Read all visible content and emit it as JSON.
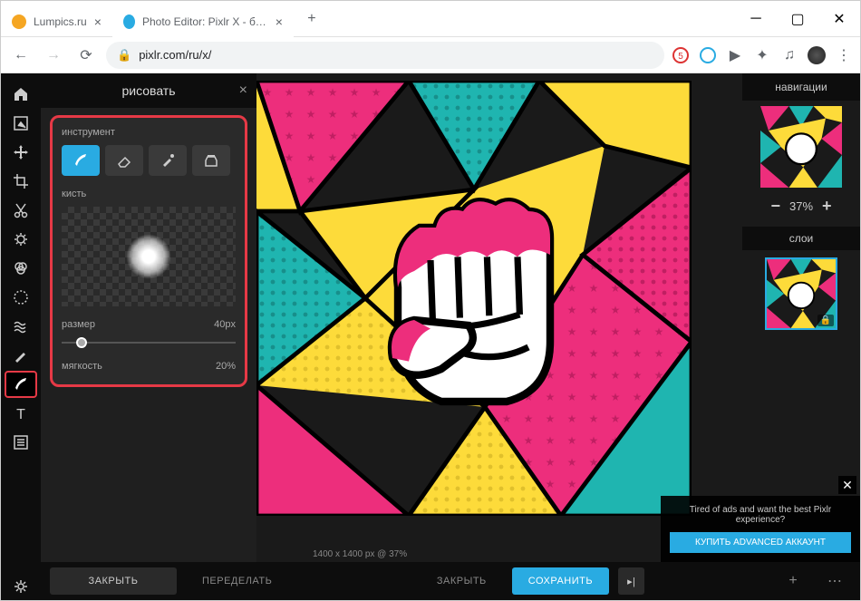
{
  "browser": {
    "tabs": [
      {
        "title": "Lumpics.ru",
        "icon_color": "#f5a623"
      },
      {
        "title": "Photo Editor: Pixlr X - бесплатн",
        "icon_color": "#29abe2"
      }
    ],
    "url": "pixlr.com/ru/x/"
  },
  "panel": {
    "title": "рисовать",
    "tool_section": "инструмент",
    "brush_section": "кисть",
    "size_label": "размер",
    "size_value": "40px",
    "softness_label": "мягкость",
    "softness_value": "20%"
  },
  "right": {
    "nav_title": "навигации",
    "zoom": "37%",
    "layers_title": "слои"
  },
  "bottom": {
    "close1": "ЗАКРЫТЬ",
    "redo": "ПЕРЕДЕЛАТЬ",
    "dimensions": "1400 x 1400 px @ 37%",
    "close2": "ЗАКРЫТЬ",
    "save": "СОХРАНИТЬ"
  },
  "ad": {
    "text": "Tired of ads and want the best Pixlr experience?",
    "button": "КУПИТЬ ADVANCED АККАУНТ"
  }
}
